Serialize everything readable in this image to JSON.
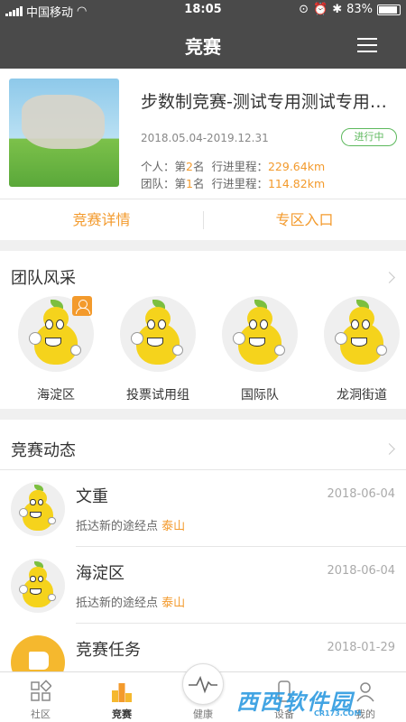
{
  "status_bar": {
    "carrier": "中国移动",
    "time": "18:05",
    "battery": "83%",
    "battery_level": 0.83
  },
  "nav": {
    "title": "竞赛"
  },
  "competition": {
    "title": "步数制竞赛-测试专用测试专用测试专用",
    "dates": "2018.05.04-2019.12.31",
    "status": "进行中",
    "personal": {
      "label": "个人：",
      "rank_prefix": "第",
      "rank": "2",
      "rank_suffix": "名",
      "distance_label": "行进里程：",
      "distance": "229.64km"
    },
    "team": {
      "label": "团队：",
      "rank_prefix": "第",
      "rank": "1",
      "rank_suffix": "名",
      "distance_label": "行进里程：",
      "distance": "114.82km"
    },
    "details_button": "竞赛详情",
    "zone_button": "专区入口"
  },
  "team_section": {
    "title": "团队风采",
    "teams": [
      {
        "name": "海淀区"
      },
      {
        "name": "投票试用组"
      },
      {
        "name": "国际队"
      },
      {
        "name": "龙洞街道"
      }
    ]
  },
  "feed_section": {
    "title": "竞赛动态",
    "items": [
      {
        "name": "文重",
        "desc": "抵达新的途经点",
        "place": "泰山",
        "date": "2018-06-04"
      },
      {
        "name": "海淀区",
        "desc": "抵达新的途经点",
        "place": "泰山",
        "date": "2018-06-04"
      },
      {
        "name": "竞赛任务",
        "date": "2018-01-29"
      }
    ]
  },
  "tabs": [
    {
      "label": "社区",
      "icon": "community-icon"
    },
    {
      "label": "竞赛",
      "icon": "competition-icon"
    },
    {
      "label": "健康",
      "icon": "health-pulse-icon"
    },
    {
      "label": "设备",
      "icon": "device-icon"
    },
    {
      "label": "我的",
      "icon": "profile-icon"
    }
  ],
  "watermark": {
    "text": "西西软件园",
    "sub": "CR173.COM"
  },
  "colors": {
    "accent": "#f39a2c",
    "nav_bg": "#4a4a4a",
    "status_green": "#5cb85c"
  }
}
